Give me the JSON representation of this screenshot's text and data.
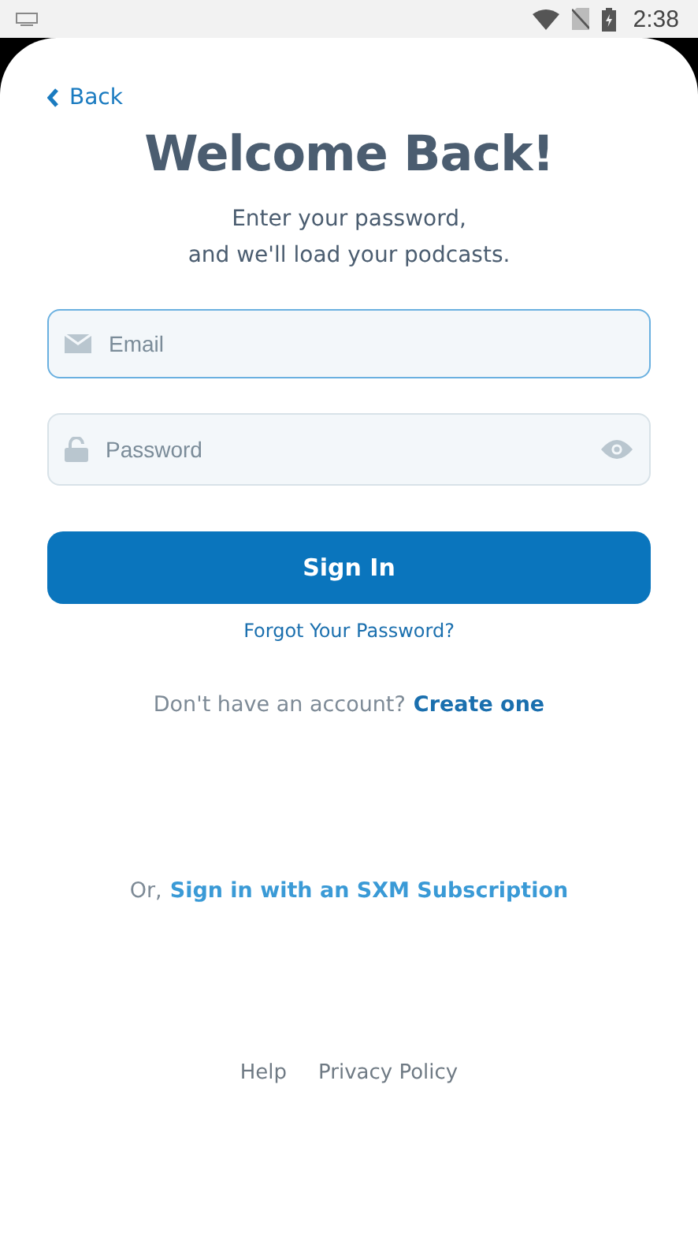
{
  "status_bar": {
    "time": "2:38"
  },
  "back": {
    "label": "Back"
  },
  "title": "Welcome Back!",
  "subtitle": [
    "Enter your password,",
    "and we'll load your podcasts."
  ],
  "fields": [
    {
      "kind": "email",
      "placeholder": "Email",
      "focused": true
    },
    {
      "kind": "password",
      "placeholder": "Password",
      "focused": false
    }
  ],
  "sign_in_button": "Sign In",
  "forgot_link": "Forgot Your Password?",
  "create_account": {
    "prompt": "Don't have an account?",
    "link": "Create one"
  },
  "sxm": {
    "prompt": "Or,",
    "link": "Sign in with an SXM Subscription"
  },
  "footer_links": [
    "Help",
    "Privacy Policy"
  ]
}
